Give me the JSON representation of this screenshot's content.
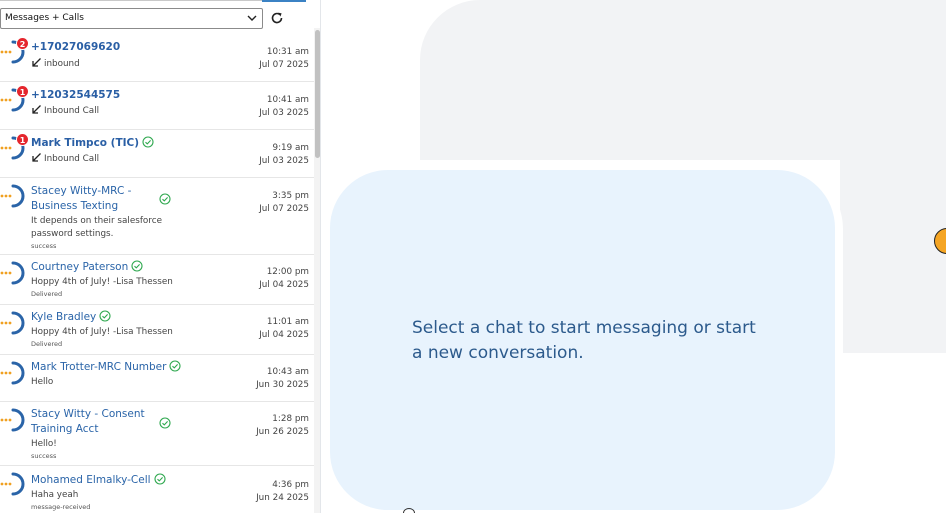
{
  "filter": {
    "selected": "Messages + Calls"
  },
  "conversations": [
    {
      "name": "+17027069620",
      "badge": "2",
      "preview": "inbound",
      "status": "",
      "time": "10:31 am",
      "date": "Jul 07 2025"
    },
    {
      "name": "+12032544575",
      "badge": "1",
      "preview": "Inbound Call",
      "status": "",
      "time": "10:41 am",
      "date": "Jul 03 2025"
    },
    {
      "name": "Mark Timpco (TIC)",
      "badge": "1",
      "preview": "Inbound Call",
      "status": "",
      "time": "9:19 am",
      "date": "Jul 03 2025"
    },
    {
      "name_line1": "Stacey Witty-MRC -",
      "name_line2": "Business Texting",
      "badge": "",
      "preview_line1": "It depends on their salesforce",
      "preview_line2": "password settings.",
      "status": "success",
      "time": "3:35 pm",
      "date": "Jul 07 2025"
    },
    {
      "name": "Courtney Paterson",
      "badge": "",
      "preview": "Hoppy 4th of July!  -Lisa Thessen",
      "status": "Delivered",
      "time": "12:00 pm",
      "date": "Jul 04 2025"
    },
    {
      "name": "Kyle Bradley",
      "badge": "",
      "preview": "Hoppy 4th of July!  -Lisa Thessen",
      "status": "Delivered",
      "time": "11:01 am",
      "date": "Jul 04 2025"
    },
    {
      "name": "Mark Trotter-MRC Number",
      "badge": "",
      "preview": "Hello",
      "status": "",
      "time": "10:43 am",
      "date": "Jun 30 2025"
    },
    {
      "name_line1": "Stacy Witty - Consent",
      "name_line2": "Training Acct",
      "badge": "",
      "preview": "Hello!",
      "status": "success",
      "time": "1:28 pm",
      "date": "Jun 26 2025"
    },
    {
      "name": "Mohamed Elmalky-Cell",
      "badge": "",
      "preview": "Haha yeah",
      "status": "message-received",
      "time": "4:36 pm",
      "date": "Jun 24 2025"
    }
  ],
  "empty_state": {
    "line1": "Select a chat to start messaging or start",
    "line2": "a new conversation."
  },
  "colors": {
    "accent": "#2a64a8",
    "badge": "#e5262d",
    "check": "#2fa84f",
    "card": "#e8f3fd",
    "avatar_dots": "#f0a020"
  },
  "icons": {
    "refresh": "refresh-icon",
    "chevron": "chevron-down-icon",
    "inbound": "inbound-arrow-icon",
    "verified": "check-circle-icon",
    "help": "help-icon"
  }
}
